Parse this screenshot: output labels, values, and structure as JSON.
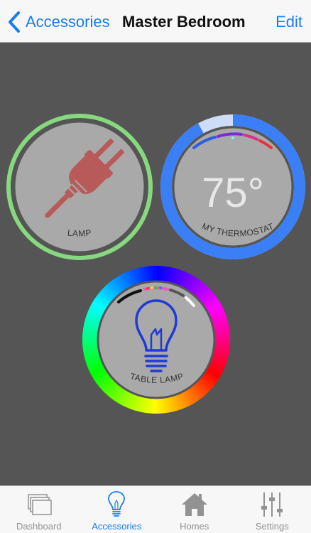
{
  "navbar": {
    "back_label": "Accessories",
    "title": "Master Bedroom",
    "edit_label": "Edit"
  },
  "accessories": {
    "lamp": {
      "label": "LAMP",
      "ring_color": "#86d97e",
      "icon_color": "#b85a59"
    },
    "thermostat": {
      "label": "MY THERMOSTAT",
      "temperature": "75°",
      "ring_color": "#3a7ff6",
      "ring_track_color": "#cddcf8",
      "level": 0.92
    },
    "table_lamp": {
      "label": "TABLE LAMP",
      "icon_color": "#1f3ad6"
    }
  },
  "tabbar": {
    "tabs": [
      {
        "label": "Dashboard",
        "icon": "dashboard-icon"
      },
      {
        "label": "Accessories",
        "icon": "bulb-icon"
      },
      {
        "label": "Homes",
        "icon": "house-icon"
      },
      {
        "label": "Settings",
        "icon": "sliders-icon"
      }
    ],
    "active_color": "#1a7cf2",
    "inactive_color": "#929292"
  }
}
